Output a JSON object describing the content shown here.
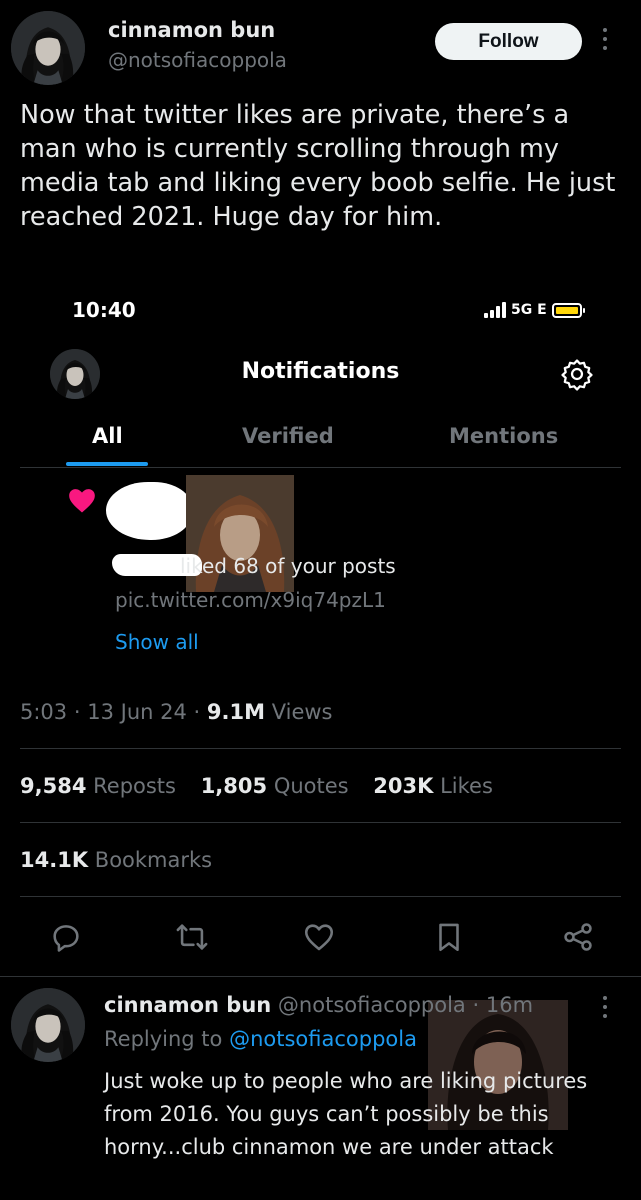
{
  "tweet": {
    "author": {
      "display_name": "cinnamon bun",
      "handle": "@notsofiacoppola"
    },
    "follow_label": "Follow",
    "text": "Now that twitter likes are private, there’s a man who is currently scrolling through my media tab and liking every boob selfie. He just reached 2021. Huge day for him.",
    "meta": {
      "time": "5:03",
      "date": "13 Jun 24",
      "views_count": "9.1M",
      "views_label": "Views",
      "sep": "·"
    },
    "stats": {
      "reposts_count": "9,584",
      "reposts_label": "Reposts",
      "quotes_count": "1,805",
      "quotes_label": "Quotes",
      "likes_count": "203K",
      "likes_label": "Likes",
      "bookmarks_count": "14.1K",
      "bookmarks_label": "Bookmarks"
    },
    "actions": [
      "reply-icon",
      "repost-icon",
      "like-icon",
      "bookmark-icon",
      "share-icon"
    ]
  },
  "screenshot": {
    "status_time": "10:40",
    "network": "5G E",
    "title": "Notifications",
    "tabs": [
      "All",
      "Verified",
      "Mentions"
    ],
    "active_tab": "All",
    "notification": {
      "text": "liked 68 of your posts",
      "link": "pic.twitter.com/x9iq74pzL1",
      "show_all": "Show all"
    }
  },
  "reply": {
    "display_name": "cinnamon bun",
    "handle": "@notsofiacoppola",
    "time": "16m",
    "sep": "·",
    "replying_label": "Replying to",
    "replying_to": "@notsofiacoppola",
    "text": "Just woke up to people who are liking pictures from 2016. You guys can’t possibly be this horny...club cinnamon we are under attack"
  },
  "colors": {
    "accent": "#1d9bf0",
    "muted": "#71767b",
    "text": "#e7e9ea",
    "heart": "#f91880",
    "battery": "#ffd60a"
  }
}
